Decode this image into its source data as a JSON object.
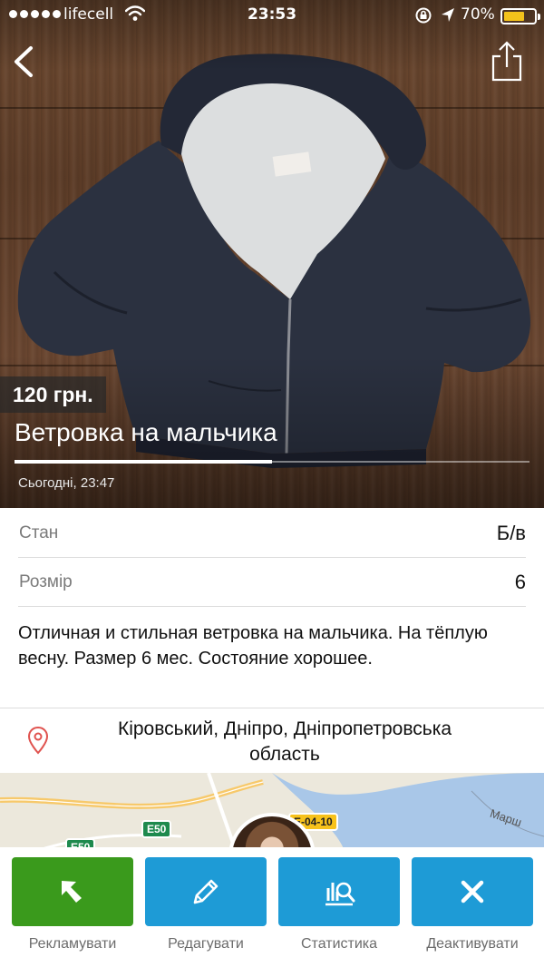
{
  "status_bar": {
    "carrier": "lifecell",
    "time": "23:53",
    "battery": "70%",
    "battery_level": 0.7,
    "battery_color": "#f3c21b"
  },
  "listing": {
    "price": "120 грн.",
    "title": "Ветровка на мальчика",
    "posted": "Сьогодні, 23:47",
    "attributes": [
      {
        "label": "Стан",
        "value": "Б/в"
      },
      {
        "label": "Розмір",
        "value": "6"
      }
    ],
    "description": "Отличная и стильная ветровка на мальчика. На тёплую весну. Размер 6 мес. Состояние хорошее.",
    "location_line1": "Кіровський, Дніпро, Дніпропетровська",
    "location_line2": "область"
  },
  "map": {
    "labels": [
      "E50",
      "E50",
      "E-04-10",
      "Марш"
    ]
  },
  "actions": [
    {
      "label": "Рекламувати",
      "icon": "cursor-arrow-icon",
      "color": "#3a9a1c"
    },
    {
      "label": "Редагувати",
      "icon": "pencil-icon",
      "color": "#1e9bd6"
    },
    {
      "label": "Статистика",
      "icon": "stats-icon",
      "color": "#1e9bd6"
    },
    {
      "label": "Деактивувати",
      "icon": "close-icon",
      "color": "#1e9bd6"
    }
  ],
  "colors": {
    "accent_green": "#3a9a1c",
    "accent_blue": "#1e9bd6",
    "pin": "#e0534f"
  }
}
